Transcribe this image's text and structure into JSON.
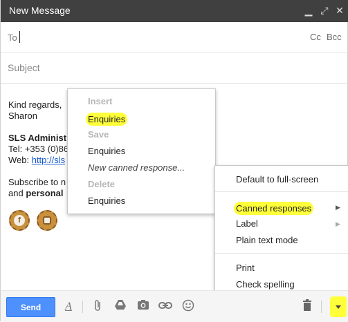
{
  "window": {
    "title": "New Message"
  },
  "to": {
    "label": "To",
    "cc": "Cc",
    "bcc": "Bcc"
  },
  "subject": {
    "placeholder": "Subject"
  },
  "signature": {
    "closing": "Kind regards,",
    "name": "Sharon",
    "org": "SLS Administ",
    "tel": "Tel: +353 (0)86",
    "web_label": "Web: ",
    "web_link": "http://sls",
    "subscribe_line1": "Subscribe to n",
    "subscribe_line2_prefix": "and ",
    "subscribe_line2_bold": "personal"
  },
  "canned_menu": {
    "insert_header": "Insert",
    "insert_item": "Enquiries",
    "save_header": "Save",
    "save_item": "Enquiries",
    "new_canned": "New canned response...",
    "delete_header": "Delete",
    "delete_item": "Enquiries"
  },
  "options_menu": {
    "default_full_screen": "Default to full-screen",
    "canned_responses": "Canned responses",
    "label": "Label",
    "plain_text_mode": "Plain text mode",
    "print": "Print",
    "check_spelling": "Check spelling"
  },
  "toolbar": {
    "send": "Send"
  },
  "colors": {
    "highlight": "#ffff3a",
    "send_blue": "#4d90fe",
    "titlebar": "#404040"
  }
}
